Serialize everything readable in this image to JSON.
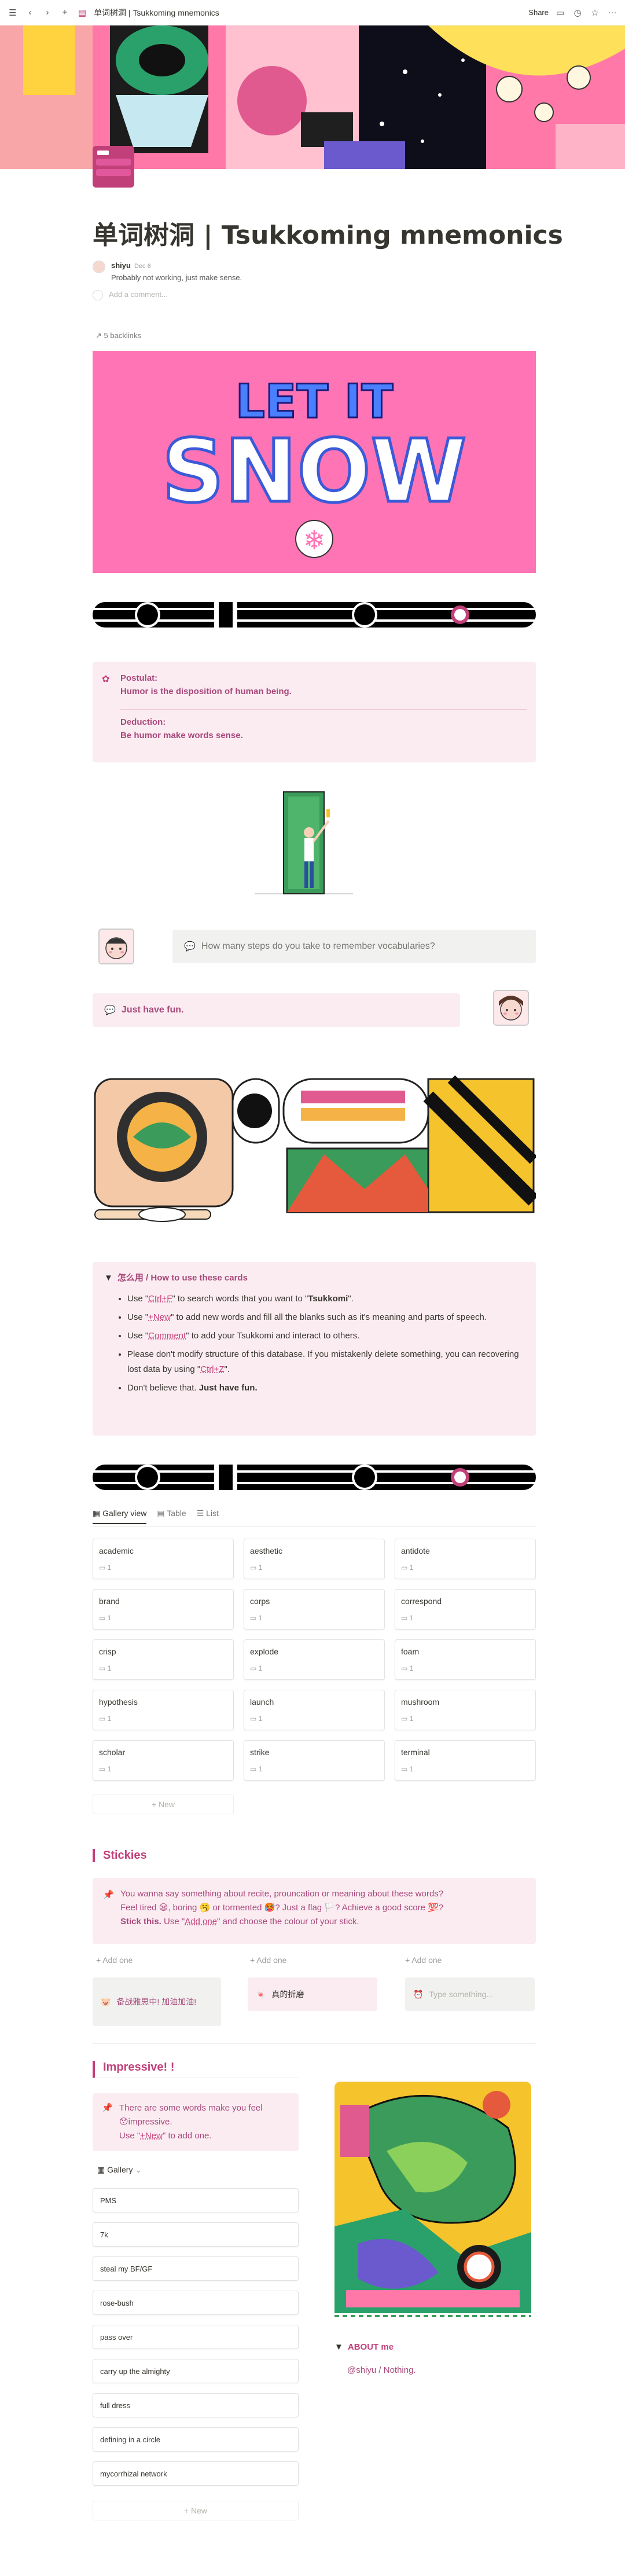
{
  "topbar": {
    "title": "单词树洞 | Tsukkoming mnemonics",
    "share": "Share"
  },
  "page": {
    "title": "单词树洞 | Tsukkoming mnemonics"
  },
  "comment": {
    "author": "shiyu",
    "date": "Dec 6",
    "text": "Probably not working, just make sense.",
    "add_placeholder": "Add a comment..."
  },
  "backlinks": "5 backlinks",
  "banner_text": "LET IT SNOW",
  "postulat": {
    "label1": "Postulat:",
    "text1": "Humor is the disposition of human being.",
    "label2": "Deduction:",
    "text2": "Be humor make words sense."
  },
  "question": "How many steps do you take to remember vocabularies?",
  "answer": "Just have fun.",
  "howto": {
    "title": "怎么用 / How to use these cards",
    "items": [
      {
        "a": "Use \"",
        "code": "Ctrl+F",
        "b": "\" to search words that you want to  \"",
        "bold": "Tsukkomi",
        "c": "\"."
      },
      {
        "a": "Use \"",
        "code": "+New",
        "b": "\" to add new words and fill all the blanks such as it's meaning and parts of speech."
      },
      {
        "a": "Use \"",
        "code": "Comment",
        "b": "\" to add your Tsukkomi and interact to others."
      },
      {
        "a": "Please don't modify structure of this database. If you mistakenly delete something, you can recovering lost data by using \"",
        "code": "Ctrl+Z",
        "b": "\"."
      },
      {
        "a": "Don't believe that. ",
        "bold": "Just have fun."
      }
    ]
  },
  "views": {
    "gallery": "Gallery view",
    "table": "Table",
    "list": "List"
  },
  "cards": [
    {
      "title": "academic",
      "count": "1"
    },
    {
      "title": "aesthetic",
      "count": "1"
    },
    {
      "title": "antidote",
      "count": "1"
    },
    {
      "title": "brand",
      "count": "1"
    },
    {
      "title": "corps",
      "count": "1"
    },
    {
      "title": "correspond",
      "count": "1"
    },
    {
      "title": "crisp",
      "count": "1"
    },
    {
      "title": "explode",
      "count": "1"
    },
    {
      "title": "foam",
      "count": "1"
    },
    {
      "title": "hypothesis",
      "count": "1"
    },
    {
      "title": "launch",
      "count": "1"
    },
    {
      "title": "mushroom",
      "count": "1"
    },
    {
      "title": "scholar",
      "count": "1"
    },
    {
      "title": "strike",
      "count": "1"
    },
    {
      "title": "terminal",
      "count": "1"
    }
  ],
  "new_label": "+ New",
  "stickies": {
    "title": "Stickies",
    "line1": "You wanna say something about recite, prouncation or meaning about these words?",
    "line2": "Feel tired 😪, boring 🥱 or tormented 🥵? Just a flag 🏳️? Achieve a good score 💯?",
    "line3a": "Stick this.",
    "line3b": " Use \"",
    "line3code": "Add one",
    "line3c": "\" and choose the colour of your stick.",
    "add_one": "+ Add one",
    "notes": [
      {
        "emoji": "🐷",
        "text": "备战雅思中! 加油加油!"
      },
      {
        "emoji": "🍬",
        "text": "真的折磨"
      },
      {
        "emoji": "⏰",
        "text": "Type something..."
      }
    ]
  },
  "impressive": {
    "title": "Impressive! !",
    "line1": "There are some words make you feel",
    "line2": "😯impressive.",
    "line3a": "Use \"",
    "line3code": "+New",
    "line3b": "\" to add one.",
    "gallery_label": "Gallery",
    "items": [
      "PMS",
      "7k",
      "steal my BF/GF",
      "rose-bush",
      "pass over",
      "carry up the almighty",
      "full dress",
      "defining in a circle",
      "mycorrhizal network"
    ],
    "new_label": "+ New"
  },
  "about": {
    "title": "ABOUT me",
    "text": "@shiyu / Nothing."
  }
}
